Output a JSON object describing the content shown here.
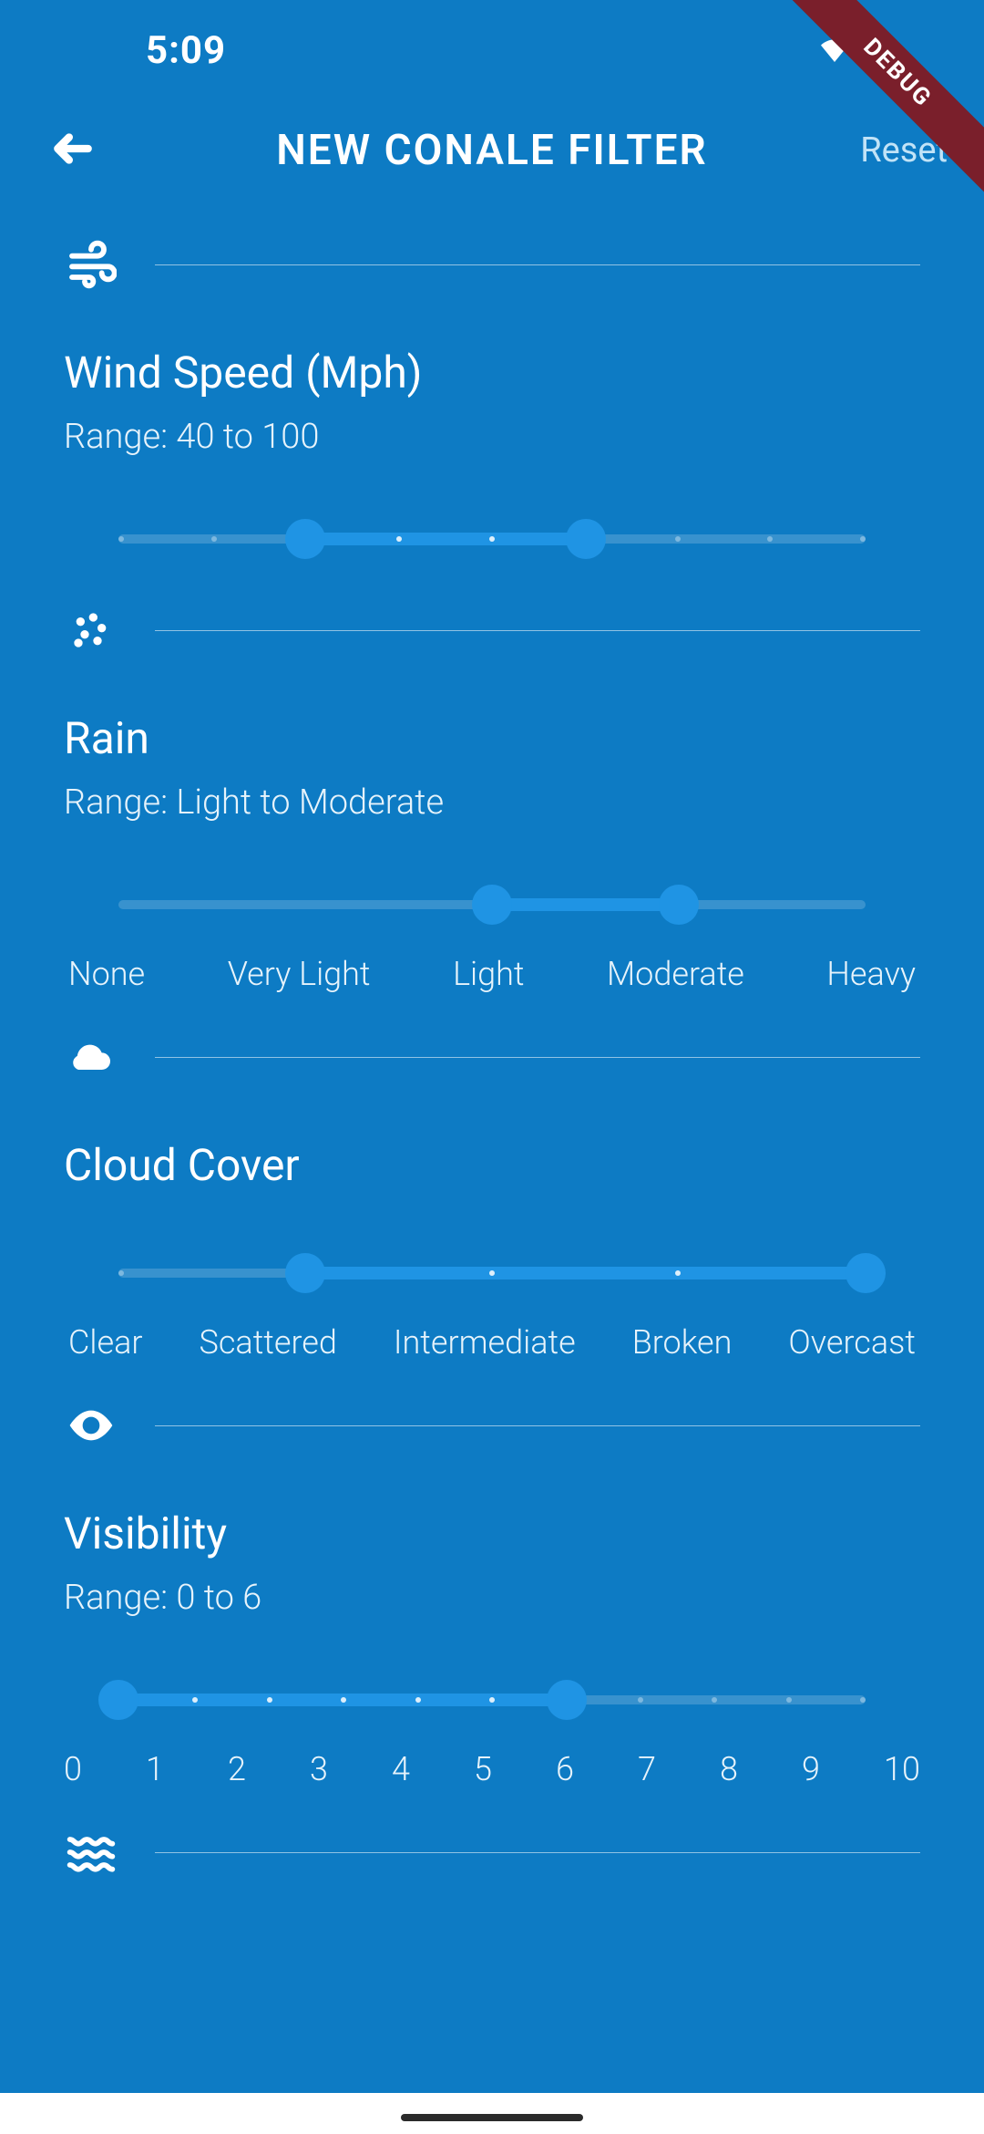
{
  "debug_label": "DEBUG",
  "statusbar": {
    "time": "5:09"
  },
  "header": {
    "title": "NEW CONALE FILTER",
    "reset": "Reset"
  },
  "sections": {
    "wind": {
      "title": "Wind Speed (Mph)",
      "range_label": "Range: 40 to 100",
      "min": 0,
      "max": 160,
      "low": 40,
      "high": 100,
      "tick_count": 9
    },
    "rain": {
      "title": "Rain",
      "range_label": "Range: Light to Moderate",
      "labels": [
        "None",
        "Very Light",
        "Light",
        "Moderate",
        "Heavy"
      ],
      "low_index": 2,
      "high_index": 3,
      "count": 5
    },
    "cloud": {
      "title": "Cloud Cover",
      "labels": [
        "Clear",
        "Scattered",
        "Intermediate",
        "Broken",
        "Overcast"
      ],
      "low_index": 1,
      "high_index": 4,
      "count": 5
    },
    "visibility": {
      "title": "Visibility",
      "range_label": "Range: 0 to 6",
      "labels": [
        "0",
        "1",
        "2",
        "3",
        "4",
        "5",
        "6",
        "7",
        "8",
        "9",
        "10"
      ],
      "low": 0,
      "high": 6,
      "max": 10
    }
  }
}
